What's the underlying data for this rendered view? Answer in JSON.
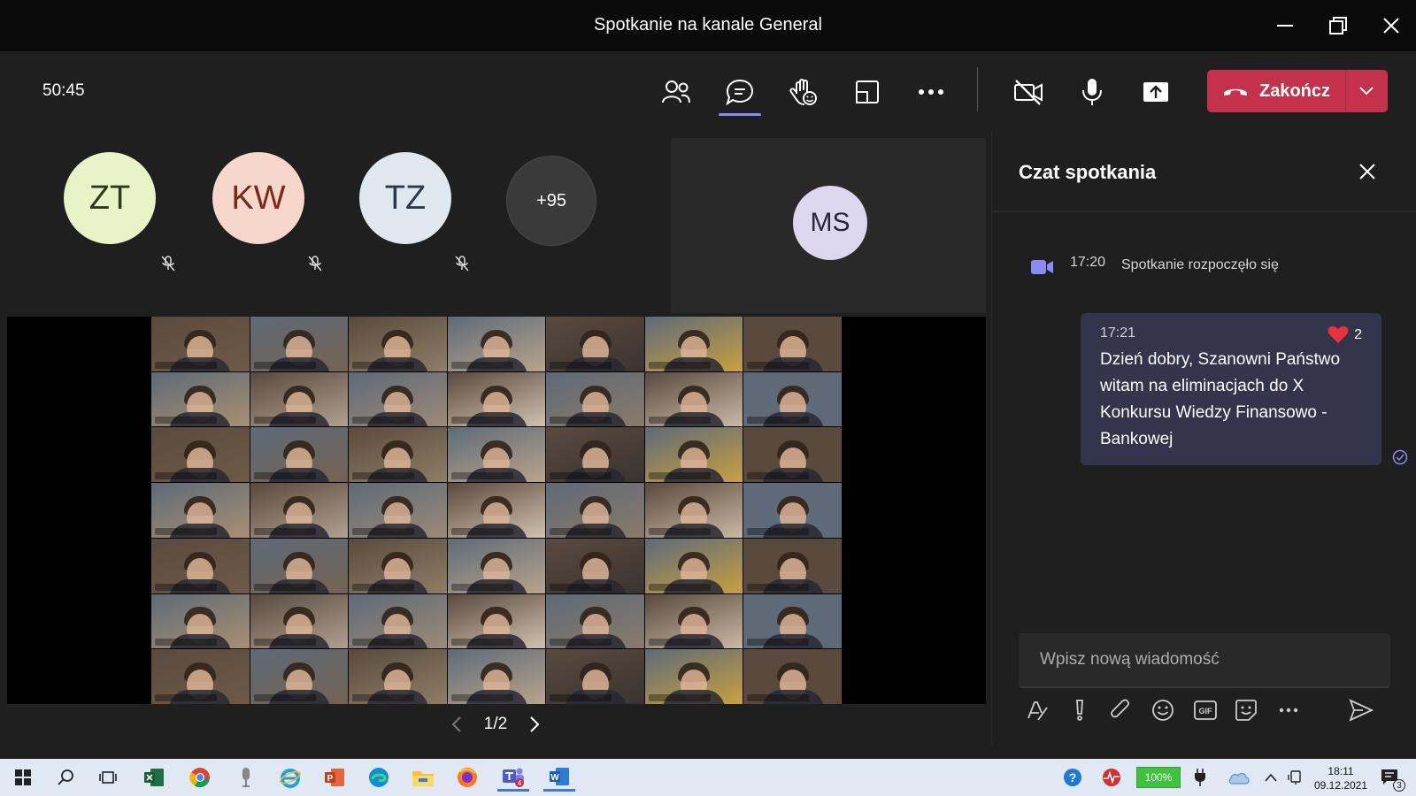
{
  "window": {
    "title": "Spotkanie na kanale General"
  },
  "toolbar": {
    "timer": "50:45",
    "end_label": "Zakończ"
  },
  "participants": [
    {
      "initials": "ZT",
      "color": "#e9f3c8"
    },
    {
      "initials": "KW",
      "color": "#f7d6cb"
    },
    {
      "initials": "TZ",
      "color": "#dfe8ee"
    },
    {
      "initials": "+95",
      "color": "#3a3a3a"
    }
  ],
  "spotlight": {
    "initials": "MS",
    "color": "#dcd6ee"
  },
  "pager": {
    "label": "1/2"
  },
  "chat": {
    "title": "Czat spotkania",
    "system": {
      "time": "17:20",
      "text": "Spotkanie rozpoczęło się"
    },
    "message": {
      "time": "17:21",
      "reaction_count": "2",
      "text": "Dzień dobry, Szanowni Państwo witam na eliminacjach do X Konkursu Wiedzy Finansowo - Bankowej"
    },
    "compose_placeholder": "Wpisz nową wiadomość"
  },
  "taskbar": {
    "battery": "100%",
    "time": "18:11",
    "date": "09.12.2021",
    "notifications": "3"
  }
}
